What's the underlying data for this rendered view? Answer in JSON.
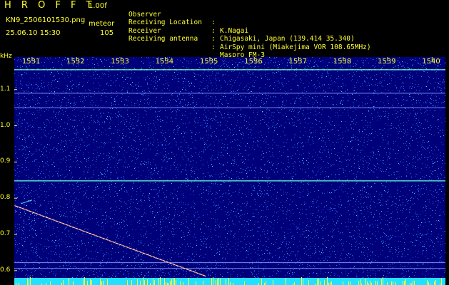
{
  "header": {
    "app_title": "H R O F F T",
    "version": "1.00f",
    "filename": "KN9_2506101530.png",
    "meteor_label": "meteor",
    "datetime": "25.06.10 15:30",
    "meteor_count": "105"
  },
  "info": {
    "observer_key": "Observer",
    "observer_val": "K.Nagai",
    "location_key": "Receiving Location",
    "location_val": "Chigasaki, Japan (139.414 35.340)",
    "receiver_key": "Receiver",
    "receiver_val": "AirSpy mini (Miakejima VOR 108.65MHz)",
    "antenna_key": "Receiving antenna",
    "antenna_val": "Maspro FM-3",
    "colon": ":"
  },
  "colors": {
    "background": "#000000",
    "text": "#ffff33",
    "plot_bg": "#00007a",
    "noise": "#2a6bff",
    "tick": "#ffff33",
    "sweep": "#ff3030"
  },
  "chart_data": {
    "type": "heatmap",
    "xlabel": "",
    "ylabel": "kHz",
    "x_ticks": [
      "1531",
      "1532",
      "1533",
      "1534",
      "1535",
      "1536",
      "1537",
      "1538",
      "1539",
      "1540"
    ],
    "x_range": [
      1530.6,
      1540.3
    ],
    "y_ticks": [
      "1.1",
      "1.0",
      "0.9",
      "0.8",
      "0.7",
      "0.6"
    ],
    "y_range": [
      0.58,
      1.19
    ],
    "horizontal_lines_khz": [
      1.155,
      1.09,
      1.05,
      0.848,
      0.622,
      0.606
    ],
    "sweep": {
      "from": [
        1530.6,
        0.78
      ],
      "to": [
        1534.9,
        0.585
      ]
    }
  }
}
